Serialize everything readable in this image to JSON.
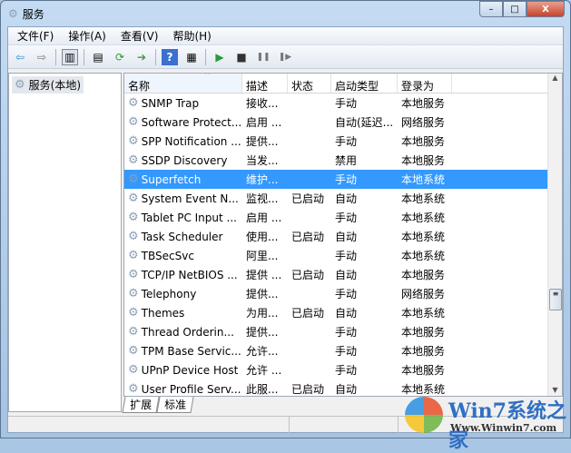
{
  "window": {
    "title": "服务",
    "minimize": "–",
    "maximize": "□",
    "close": "X"
  },
  "menu": [
    "文件(F)",
    "操作(A)",
    "查看(V)",
    "帮助(H)"
  ],
  "toolbar": {
    "back": "⇦",
    "forward": "⇨",
    "start": "▶",
    "stop": "■",
    "pause": "❚❚",
    "restart": "❚▶"
  },
  "tree": {
    "root": "服务(本地)"
  },
  "columns": [
    "名称",
    "描述",
    "状态",
    "启动类型",
    "登录为"
  ],
  "rows": [
    [
      "SNMP Trap",
      "接收...",
      "",
      "手动",
      "本地服务"
    ],
    [
      "Software Protect...",
      "启用 ...",
      "",
      "自动(延迟...",
      "网络服务"
    ],
    [
      "SPP Notification ...",
      "提供...",
      "",
      "手动",
      "本地服务"
    ],
    [
      "SSDP Discovery",
      "当发...",
      "",
      "禁用",
      "本地服务"
    ],
    [
      "Superfetch",
      "维护...",
      "",
      "手动",
      "本地系统"
    ],
    [
      "System Event N...",
      "监视...",
      "已启动",
      "自动",
      "本地系统"
    ],
    [
      "Tablet PC Input ...",
      "启用 ...",
      "",
      "手动",
      "本地系统"
    ],
    [
      "Task Scheduler",
      "使用...",
      "已启动",
      "自动",
      "本地系统"
    ],
    [
      "TBSecSvc",
      "阿里...",
      "",
      "手动",
      "本地系统"
    ],
    [
      "TCP/IP NetBIOS ...",
      "提供 ...",
      "已启动",
      "自动",
      "本地服务"
    ],
    [
      "Telephony",
      "提供...",
      "",
      "手动",
      "网络服务"
    ],
    [
      "Themes",
      "为用...",
      "已启动",
      "自动",
      "本地系统"
    ],
    [
      "Thread Orderin...",
      "提供...",
      "",
      "手动",
      "本地服务"
    ],
    [
      "TPM Base Servic...",
      "允许...",
      "",
      "手动",
      "本地服务"
    ],
    [
      "UPnP Device Host",
      "允许 ...",
      "",
      "手动",
      "本地服务"
    ],
    [
      "User Profile Serv...",
      "此服...",
      "已启动",
      "自动",
      "本地系统"
    ]
  ],
  "selected_row": 4,
  "tabs": [
    "扩展",
    "标准"
  ],
  "watermark": {
    "brand": "Win7系统之家",
    "url": "Www.Winwin7.com"
  }
}
